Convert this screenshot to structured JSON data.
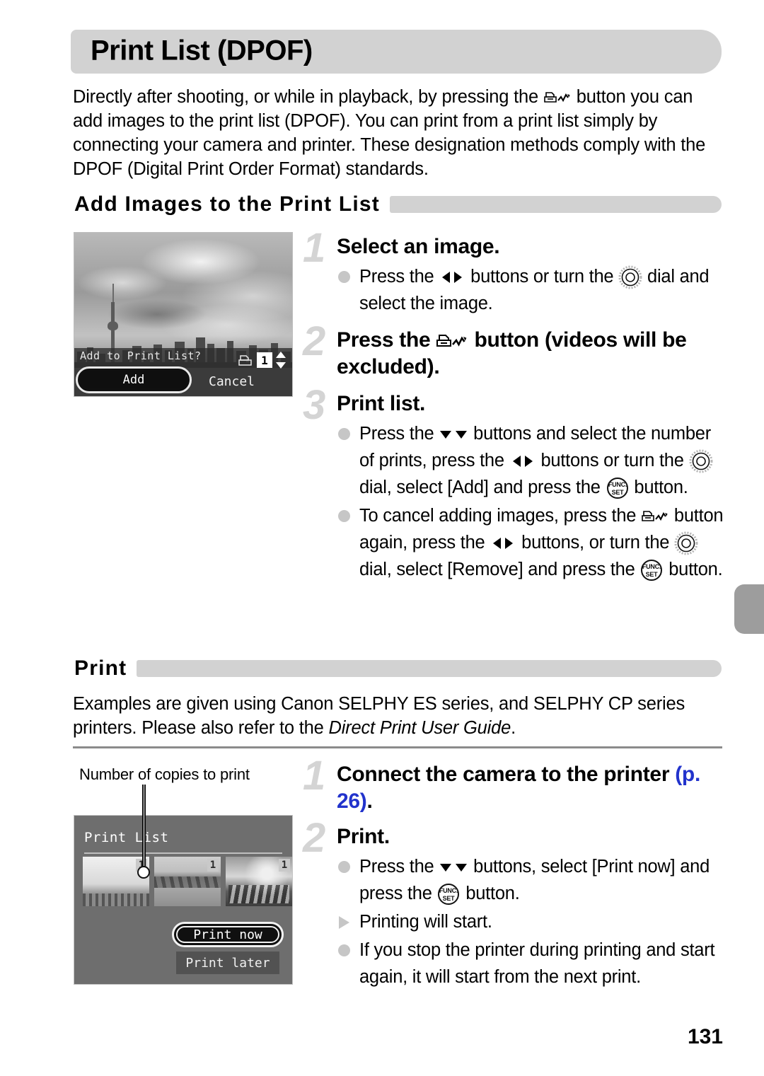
{
  "page": {
    "title": "Print List (DPOF)",
    "number": "131"
  },
  "intro": {
    "part1": "Directly after shooting, or while in playback, by pressing the ",
    "icon": "print-dpof-icon",
    "part2": " button you can add images to the print list (DPOF). You can print from a print list simply by connecting your camera and printer. These designation methods comply with the DPOF (Digital Print Order Format) standards."
  },
  "sections": [
    {
      "id": "add-images",
      "heading": "Add Images to the Print List"
    },
    {
      "id": "print",
      "heading": "Print"
    }
  ],
  "print_section": {
    "body_part1": "Examples are given using Canon SELPHY ES series, and SELPHY CP series printers. Please also refer to the ",
    "body_italic": "Direct Print User Guide",
    "body_part2": "."
  },
  "steps_add": [
    {
      "number": "1",
      "title": "Select an image.",
      "bullets": [
        {
          "marker": "dot",
          "segments": [
            {
              "type": "text",
              "value": "Press the "
            },
            {
              "type": "icon",
              "value": "left-right-buttons-icon"
            },
            {
              "type": "text",
              "value": " buttons or turn the "
            },
            {
              "type": "icon",
              "value": "control-dial-icon"
            },
            {
              "type": "text",
              "value": " dial and select the image."
            }
          ]
        }
      ]
    },
    {
      "number": "2",
      "title_part1": "Press the ",
      "title_icon": "print-dpof-icon",
      "title_part2": " button (videos will be excluded).",
      "bullets": []
    },
    {
      "number": "3",
      "title": "Print list.",
      "bullets": [
        {
          "marker": "dot",
          "segments": [
            {
              "type": "text",
              "value": "Press the "
            },
            {
              "type": "icon",
              "value": "up-down-buttons-icon"
            },
            {
              "type": "text",
              "value": " buttons and select the number of prints, press the "
            },
            {
              "type": "icon",
              "value": "left-right-buttons-icon"
            },
            {
              "type": "text",
              "value": " buttons or turn the "
            },
            {
              "type": "icon",
              "value": "control-dial-icon"
            },
            {
              "type": "text",
              "value": " dial, select [Add] and press the "
            },
            {
              "type": "icon",
              "value": "func-set-button-icon"
            },
            {
              "type": "text",
              "value": " button."
            }
          ]
        },
        {
          "marker": "dot",
          "segments": [
            {
              "type": "text",
              "value": "To cancel adding images, press the "
            },
            {
              "type": "icon",
              "value": "print-dpof-icon"
            },
            {
              "type": "text",
              "value": " button again, press the "
            },
            {
              "type": "icon",
              "value": "left-right-buttons-icon"
            },
            {
              "type": "text",
              "value": " buttons, or turn the "
            },
            {
              "type": "icon",
              "value": "control-dial-icon"
            },
            {
              "type": "text",
              "value": " dial, select [Remove] and press the "
            },
            {
              "type": "icon",
              "value": "func-set-button-icon"
            },
            {
              "type": "text",
              "value": " button."
            }
          ]
        }
      ]
    }
  ],
  "steps_print": [
    {
      "number": "1",
      "title_part1": "Connect the camera to the printer ",
      "title_link": "(p. 26)",
      "title_part2": ".",
      "bullets": []
    },
    {
      "number": "2",
      "title": "Print.",
      "bullets": [
        {
          "marker": "dot",
          "segments": [
            {
              "type": "text",
              "value": "Press the "
            },
            {
              "type": "icon",
              "value": "up-down-buttons-icon"
            },
            {
              "type": "text",
              "value": " buttons, select [Print now] and press the "
            },
            {
              "type": "icon",
              "value": "func-set-button-icon"
            },
            {
              "type": "text",
              "value": " button."
            }
          ]
        },
        {
          "marker": "triangle",
          "segments": [
            {
              "type": "text",
              "value": "Printing will start."
            }
          ]
        },
        {
          "marker": "dot",
          "segments": [
            {
              "type": "text",
              "value": "If you stop the printer during printing and start again, it will start from the next print."
            }
          ]
        }
      ]
    }
  ],
  "camera_screen_1": {
    "photo_description": "city skyline with clouds",
    "prompt": "Add to Print List?",
    "button_add": "Add",
    "button_cancel": "Cancel",
    "print_count": "1"
  },
  "camera_screen_2": {
    "callout_label": "Number of copies to print",
    "title": "Print List",
    "thumbnails": [
      {
        "badge": "1"
      },
      {
        "badge": "1"
      },
      {
        "badge": "1"
      }
    ],
    "button_print_now": "Print now",
    "button_print_later": "Print later"
  },
  "colors": {
    "heading_bar": "#d2d2d2",
    "step_number": "#d4d4d4",
    "link_blue": "#2233cc",
    "divider": "#8b8b8b",
    "edge_tab": "#9d9d9d"
  }
}
